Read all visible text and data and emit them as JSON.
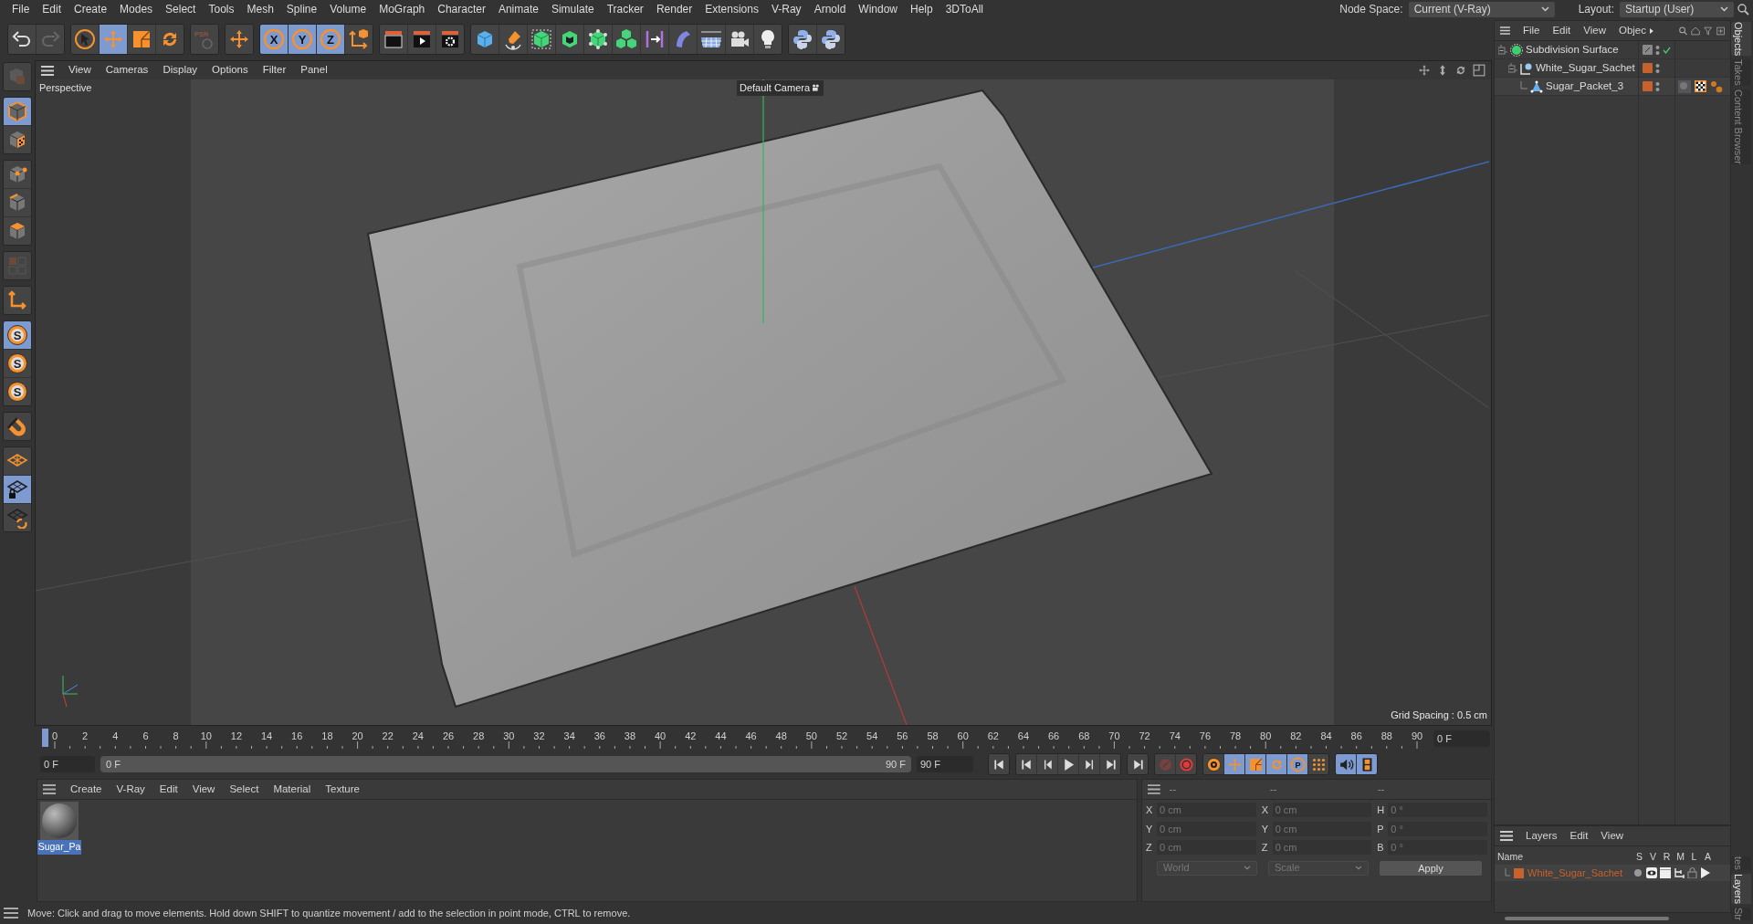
{
  "menu_bar": {
    "items": [
      "File",
      "Edit",
      "Create",
      "Modes",
      "Select",
      "Tools",
      "Mesh",
      "Spline",
      "Volume",
      "MoGraph",
      "Character",
      "Animate",
      "Simulate",
      "Tracker",
      "Render",
      "Extensions",
      "V-Ray",
      "Arnold",
      "Window",
      "Help",
      "3DToAll"
    ],
    "node_space": {
      "label": "Node Space:",
      "value": "Current (V-Ray)"
    },
    "layout": {
      "label": "Layout:",
      "value": "Startup (User)"
    }
  },
  "main_toolbar": [
    [
      {
        "kind": "undo",
        "selected": false
      },
      {
        "kind": "redo",
        "selected": false
      }
    ],
    [
      {
        "kind": "select",
        "selected": false
      },
      {
        "kind": "move",
        "selected": true
      },
      {
        "kind": "scale",
        "selected": false
      },
      {
        "kind": "rotate",
        "selected": false
      }
    ],
    [
      {
        "kind": "psr",
        "label": "PSR",
        "selected": false
      }
    ],
    [
      {
        "kind": "move",
        "selected": false
      }
    ],
    [
      {
        "kind": "axis",
        "label": "X",
        "selected": true
      },
      {
        "kind": "axis",
        "label": "Y",
        "selected": true
      },
      {
        "kind": "axis",
        "label": "Z",
        "selected": true
      },
      {
        "kind": "coords",
        "selected": false
      }
    ],
    [
      {
        "kind": "render_view",
        "selected": false
      },
      {
        "kind": "render",
        "selected": false
      },
      {
        "kind": "render_settings",
        "selected": false
      }
    ],
    [
      {
        "kind": "cube",
        "selected": false
      },
      {
        "kind": "pen",
        "selected": false
      },
      {
        "kind": "subdivision",
        "selected": false
      },
      {
        "kind": "extrude",
        "selected": false
      },
      {
        "kind": "cloner",
        "selected": false
      },
      {
        "kind": "cubes",
        "selected": false
      },
      {
        "kind": "symmetry",
        "selected": false
      },
      {
        "kind": "deformer",
        "selected": false
      },
      {
        "kind": "floor",
        "selected": false
      },
      {
        "kind": "camera",
        "selected": false
      },
      {
        "kind": "light",
        "selected": false
      }
    ],
    [
      {
        "kind": "python",
        "selected": false
      },
      {
        "kind": "python",
        "selected": false
      }
    ]
  ],
  "left_toolbar": [
    [
      {
        "kind": "model",
        "selected": false
      }
    ],
    [
      {
        "kind": "object",
        "selected": true
      },
      {
        "kind": "texture",
        "selected": false
      }
    ],
    [
      {
        "kind": "points",
        "selected": false
      },
      {
        "kind": "edges",
        "selected": false
      },
      {
        "kind": "polygons",
        "selected": false
      }
    ],
    [
      {
        "kind": "uv",
        "selected": false
      }
    ],
    [
      {
        "kind": "axis_tool",
        "selected": false
      }
    ],
    [
      {
        "kind": "snap",
        "label": "S",
        "selected": true
      },
      {
        "kind": "snap",
        "label": "S",
        "selected": false
      },
      {
        "kind": "snap",
        "label": "S",
        "selected": false
      }
    ],
    [
      {
        "kind": "magnet",
        "selected": false
      }
    ],
    [
      {
        "kind": "workplane",
        "selected": false
      },
      {
        "kind": "workplane_lock",
        "selected": true
      },
      {
        "kind": "workplane_sync",
        "selected": false
      }
    ]
  ],
  "viewport": {
    "menu": [
      "View",
      "Cameras",
      "Display",
      "Options",
      "Filter",
      "Panel"
    ],
    "label": "Perspective",
    "camera": "Default Camera",
    "grid_spacing": "Grid Spacing : 0.5 cm"
  },
  "timeline": {
    "ticks": [
      "0",
      "2",
      "4",
      "6",
      "8",
      "10",
      "12",
      "14",
      "16",
      "18",
      "20",
      "22",
      "24",
      "26",
      "28",
      "30",
      "32",
      "34",
      "36",
      "38",
      "40",
      "42",
      "44",
      "46",
      "48",
      "50",
      "52",
      "54",
      "56",
      "58",
      "60",
      "62",
      "64",
      "66",
      "68",
      "70",
      "72",
      "74",
      "76",
      "78",
      "80",
      "82",
      "84",
      "86",
      "88",
      "90"
    ],
    "current_frame": "0 F",
    "start": "0 F",
    "range_slider": {
      "level": 1
    },
    "range_start": "0 F",
    "range_end": "90 F",
    "end": "90 F",
    "transport": [
      [
        {
          "kind": "first",
          "selected": false
        }
      ],
      [
        {
          "kind": "prev_key",
          "selected": false
        },
        {
          "kind": "prev",
          "selected": false
        },
        {
          "kind": "play",
          "selected": false
        },
        {
          "kind": "next",
          "selected": false
        },
        {
          "kind": "next_key",
          "selected": false
        }
      ],
      [
        {
          "kind": "last",
          "selected": false
        }
      ],
      [
        {
          "kind": "record",
          "selected": false
        },
        {
          "kind": "autokey",
          "selected": false
        }
      ],
      [
        {
          "kind": "keyframe",
          "selected": false
        },
        {
          "kind": "move",
          "selected": true
        },
        {
          "kind": "scale",
          "selected": true
        },
        {
          "kind": "rotate",
          "selected": true
        },
        {
          "kind": "param",
          "label": "P",
          "selected": true
        },
        {
          "kind": "pla",
          "selected": false
        }
      ],
      [
        {
          "kind": "sound",
          "selected": true
        },
        {
          "kind": "film",
          "selected": true
        }
      ]
    ]
  },
  "material_manager": {
    "menu": [
      "Create",
      "V-Ray",
      "Edit",
      "View",
      "Select",
      "Material",
      "Texture"
    ],
    "materials": [
      {
        "name": "Sugar_Pa",
        "selected": true
      }
    ]
  },
  "coordinates": {
    "headers": [
      "--",
      "--",
      "--"
    ],
    "rows": [
      {
        "pos_label": "X",
        "pos": "0 cm",
        "size_label": "X",
        "size": "0 cm",
        "rot_label": "H",
        "rot": "0 °"
      },
      {
        "pos_label": "Y",
        "pos": "0 cm",
        "size_label": "Y",
        "size": "0 cm",
        "rot_label": "P",
        "rot": "0 °"
      },
      {
        "pos_label": "Z",
        "pos": "0 cm",
        "size_label": "Z",
        "size": "0 cm",
        "rot_label": "B",
        "rot": "0 °"
      }
    ],
    "dropdowns": [
      "World",
      "Scale"
    ],
    "apply": "Apply"
  },
  "objects": {
    "menu": [
      "File",
      "Edit",
      "View",
      "Objec"
    ],
    "items": [
      {
        "kind": "subdivision",
        "name": "Subdivision Surface",
        "children": [
          {
            "kind": "null",
            "name": "White_Sugar_Sachet",
            "color": "#c8622c",
            "children": [
              {
                "kind": "polygon",
                "name": "Sugar_Packet_3",
                "color": "#c8622c"
              }
            ]
          }
        ]
      }
    ]
  },
  "side_tabs_top": [
    {
      "label": "Objects",
      "selected": true
    },
    {
      "label": "Takes",
      "selected": false
    },
    {
      "label": "Content Browser",
      "selected": false
    }
  ],
  "side_tabs_bottom": [
    {
      "label": "tes",
      "selected": false
    },
    {
      "label": "Layers",
      "selected": true
    },
    {
      "label": "Str",
      "selected": false
    }
  ],
  "layers": {
    "menu": [
      "Layers",
      "Edit",
      "View"
    ],
    "columns": [
      "Name",
      "S",
      "V",
      "R",
      "M",
      "L",
      "A"
    ],
    "rows": [
      {
        "name": "White_Sugar_Sachet",
        "color": "#c8622c"
      }
    ]
  },
  "status_bar": "Move: Click and drag to move elements. Hold down SHIFT to quantize movement / add to the selection in point mode, CTRL to remove."
}
